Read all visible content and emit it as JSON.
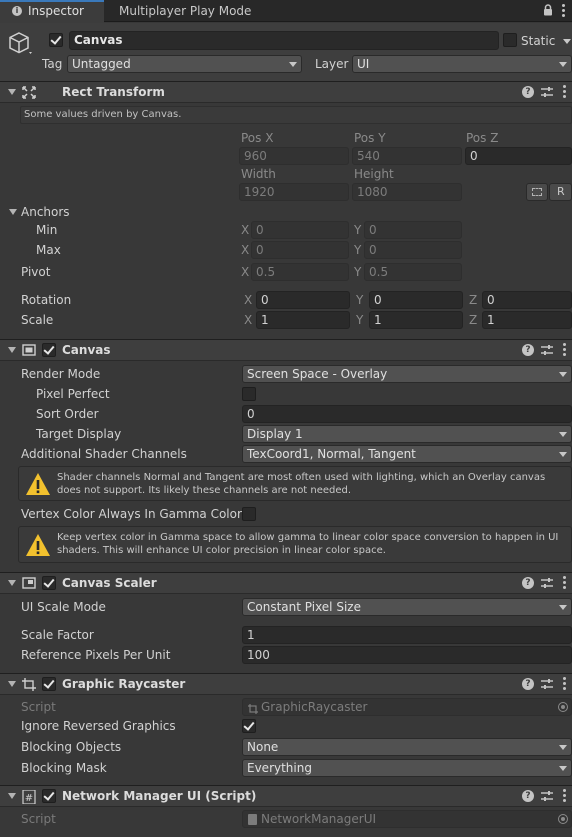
{
  "tabs": [
    {
      "label": "Inspector",
      "icon": "info-icon",
      "active": true
    },
    {
      "label": "Multiplayer Play Mode",
      "active": false
    }
  ],
  "gameobject": {
    "name": "Canvas",
    "active": true,
    "static_label": "Static",
    "static_checked": false,
    "tag_label": "Tag",
    "tag_value": "Untagged",
    "layer_label": "Layer",
    "layer_value": "UI"
  },
  "rect_transform": {
    "title": "Rect Transform",
    "driven_note": "Some values driven by Canvas.",
    "pos_x_label": "Pos X",
    "pos_y_label": "Pos Y",
    "pos_z_label": "Pos Z",
    "pos_x": "960",
    "pos_y": "540",
    "pos_z": "0",
    "width_label": "Width",
    "height_label": "Height",
    "width": "1920",
    "height": "1080",
    "r_button": "R",
    "anchors_label": "Anchors",
    "min_label": "Min",
    "max_label": "Max",
    "min_x": "0",
    "min_y": "0",
    "max_x": "0",
    "max_y": "0",
    "pivot_label": "Pivot",
    "pivot_x": "0.5",
    "pivot_y": "0.5",
    "rotation_label": "Rotation",
    "rot_x": "0",
    "rot_y": "0",
    "rot_z": "0",
    "scale_label": "Scale",
    "scale_x": "1",
    "scale_y": "1",
    "scale_z": "1",
    "x": "X",
    "y": "Y",
    "z": "Z"
  },
  "canvas": {
    "title": "Canvas",
    "enabled": true,
    "render_mode_label": "Render Mode",
    "render_mode": "Screen Space - Overlay",
    "pixel_perfect_label": "Pixel Perfect",
    "pixel_perfect": false,
    "sort_order_label": "Sort Order",
    "sort_order": "0",
    "target_display_label": "Target Display",
    "target_display": "Display 1",
    "shader_channels_label": "Additional Shader Channels",
    "shader_channels": "TexCoord1, Normal, Tangent",
    "warning1": "Shader channels Normal and Tangent are most often used with lighting, which an Overlay canvas does not support. Its likely these channels are not needed.",
    "vertex_color_label": "Vertex Color Always In Gamma Color S",
    "vertex_color": false,
    "warning2": "Keep vertex color in Gamma space to allow gamma to linear color space conversion to happen in UI shaders. This will enhance UI color precision in linear color space."
  },
  "canvas_scaler": {
    "title": "Canvas Scaler",
    "enabled": true,
    "ui_scale_mode_label": "UI Scale Mode",
    "ui_scale_mode": "Constant Pixel Size",
    "scale_factor_label": "Scale Factor",
    "scale_factor": "1",
    "ref_ppu_label": "Reference Pixels Per Unit",
    "ref_ppu": "100"
  },
  "graphic_raycaster": {
    "title": "Graphic Raycaster",
    "enabled": true,
    "script_label": "Script",
    "script": "GraphicRaycaster",
    "ignore_reversed_label": "Ignore Reversed Graphics",
    "ignore_reversed": true,
    "blocking_objects_label": "Blocking Objects",
    "blocking_objects": "None",
    "blocking_mask_label": "Blocking Mask",
    "blocking_mask": "Everything"
  },
  "network_manager_ui": {
    "title": "Network Manager UI (Script)",
    "enabled": true,
    "script_label": "Script",
    "script": "NetworkManagerUI"
  },
  "colors": {
    "background": "#383838",
    "header": "#3e3e3e",
    "field": "#2a2a2a",
    "dropdown": "#515151",
    "warning": "#f2c12e"
  }
}
